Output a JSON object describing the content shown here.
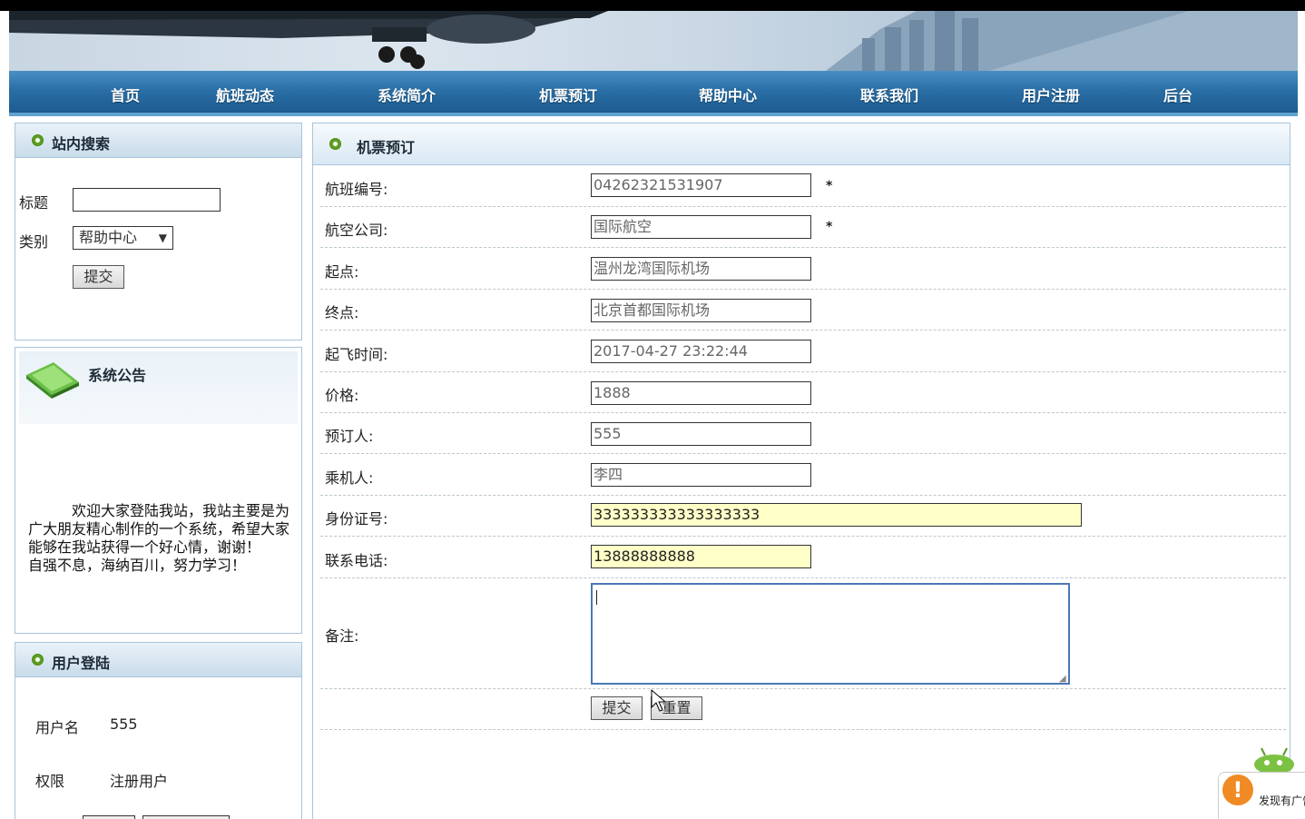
{
  "nav": {
    "items": [
      "首页",
      "航班动态",
      "系统简介",
      "机票预订",
      "帮助中心",
      "联系我们",
      "用户注册",
      "后台"
    ]
  },
  "search": {
    "title": "站内搜索",
    "title_label": "标题",
    "type_label": "类别",
    "type_value": "帮助中心",
    "submit": "提交"
  },
  "notice": {
    "title": "系统公告",
    "text": "　　　欢迎大家登陆我站，我站主要是为广大朋友精心制作的一个系统，希望大家能够在我站获得一个好心情，谢谢！　　　自强不息，海纳百川，努力学习！"
  },
  "login": {
    "title": "用户登陆",
    "username_label": "用户名",
    "username_value": "555",
    "role_label": "权限",
    "role_value": "注册用户"
  },
  "booking": {
    "title": "机票预订",
    "required_mark": "*",
    "fields": [
      {
        "label": "航班编号:",
        "value": "04262321531907"
      },
      {
        "label": "航空公司:",
        "value": "国际航空"
      },
      {
        "label": "起点:",
        "value": "温州龙湾国际机场"
      },
      {
        "label": "终点:",
        "value": "北京首都国际机场"
      },
      {
        "label": "起飞时间:",
        "value": "2017-04-27 23:22:44"
      },
      {
        "label": "价格:",
        "value": "1888"
      },
      {
        "label": "预订人:",
        "value": "555"
      },
      {
        "label": "乘机人:",
        "value": "李四"
      },
      {
        "label": "身份证号:",
        "value": "333333333333333333"
      },
      {
        "label": "联系电话:",
        "value": "13888888888"
      },
      {
        "label": "备注:",
        "value": ""
      }
    ],
    "submit": "提交",
    "reset": "重置"
  },
  "popup": {
    "text": "发现有广告",
    "icon": "warning-icon"
  }
}
